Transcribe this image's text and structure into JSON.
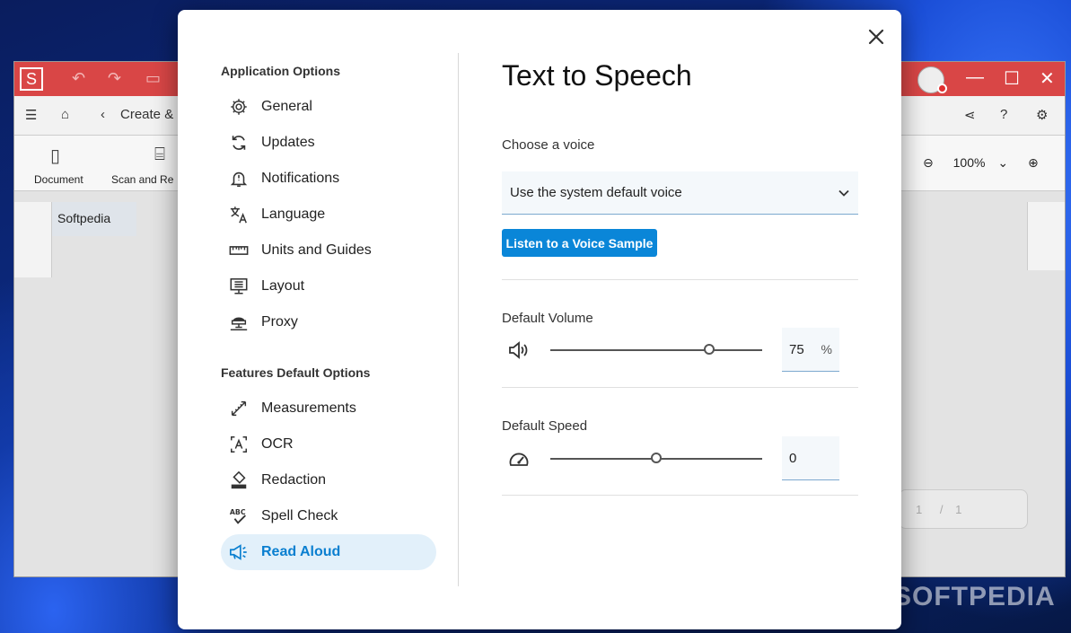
{
  "background_app": {
    "logo_letter": "S",
    "breadcrumb": "Create & C",
    "ribbon_items": [
      "Document",
      "Scan and Re"
    ],
    "zoom": "100%",
    "tab_label": "Softpedia",
    "page_current": "1",
    "page_separator": "/",
    "page_total": "1",
    "title_color": "#d94646"
  },
  "watermark": "SOFTPEDIA",
  "dialog": {
    "close_icon": "close-icon",
    "nav": {
      "section_application": "Application Options",
      "application_items": [
        {
          "label": "General",
          "icon": "gear-icon"
        },
        {
          "label": "Updates",
          "icon": "refresh-icon"
        },
        {
          "label": "Notifications",
          "icon": "bell-icon"
        },
        {
          "label": "Language",
          "icon": "translate-icon"
        },
        {
          "label": "Units and Guides",
          "icon": "ruler-icon"
        },
        {
          "label": "Layout",
          "icon": "monitor-layout-icon"
        },
        {
          "label": "Proxy",
          "icon": "network-icon"
        }
      ],
      "section_features": "Features Default Options",
      "feature_items": [
        {
          "label": "Measurements",
          "icon": "measure-icon"
        },
        {
          "label": "OCR",
          "icon": "ocr-icon"
        },
        {
          "label": "Redaction",
          "icon": "eraser-icon"
        },
        {
          "label": "Spell Check",
          "icon": "spellcheck-icon"
        },
        {
          "label": "Read Aloud",
          "icon": "megaphone-icon",
          "active": true
        }
      ],
      "accent_color": "#0a7fd0"
    },
    "content": {
      "title": "Text to Speech",
      "voice_label": "Choose a voice",
      "voice_value": "Use the system default voice",
      "sample_button": "Listen to a Voice Sample",
      "volume_label": "Default Volume",
      "volume_value": "75",
      "volume_unit": "%",
      "volume_fraction": 0.75,
      "speed_label": "Default Speed",
      "speed_value": "0",
      "speed_fraction": 0.5,
      "button_color": "#0a86d8"
    }
  }
}
